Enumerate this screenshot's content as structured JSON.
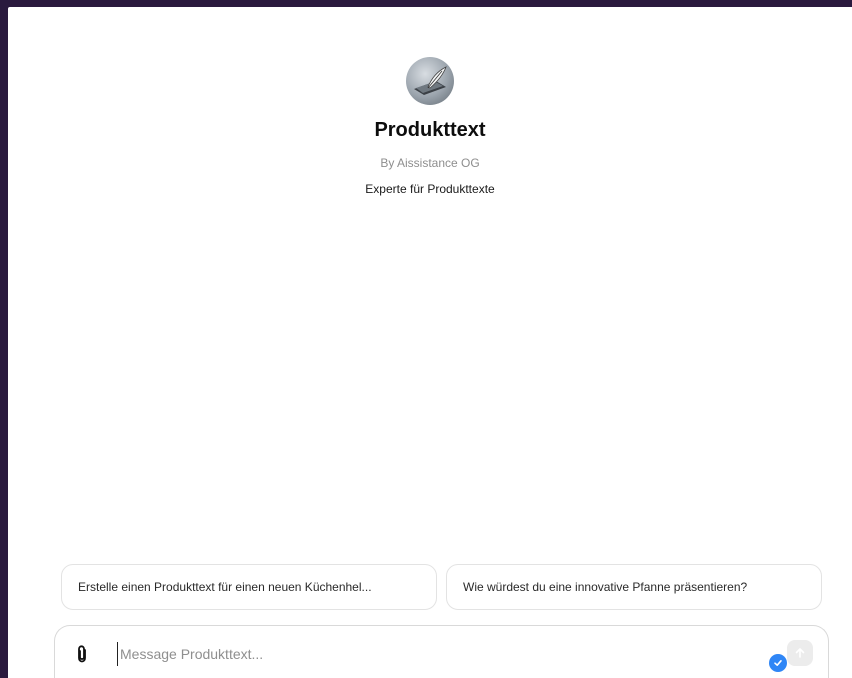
{
  "gpt": {
    "name": "Produkttext",
    "author": "By Aissistance OG",
    "description": "Experte für Produkttexte"
  },
  "suggestions": [
    {
      "label": "Erstelle einen Produkttext für einen neuen Küchenhel..."
    },
    {
      "label": "Wie würdest du eine innovative Pfanne präsentieren?"
    }
  ],
  "composer": {
    "placeholder": "Message Produkttext..."
  },
  "icons": {
    "avatar": "quill-on-device-logo",
    "attach": "paperclip-icon",
    "send": "arrow-up-icon",
    "badge": "checkmark-badge-icon"
  },
  "colors": {
    "outer_background": "#2a1a3e",
    "badge": "#2f86f6"
  }
}
